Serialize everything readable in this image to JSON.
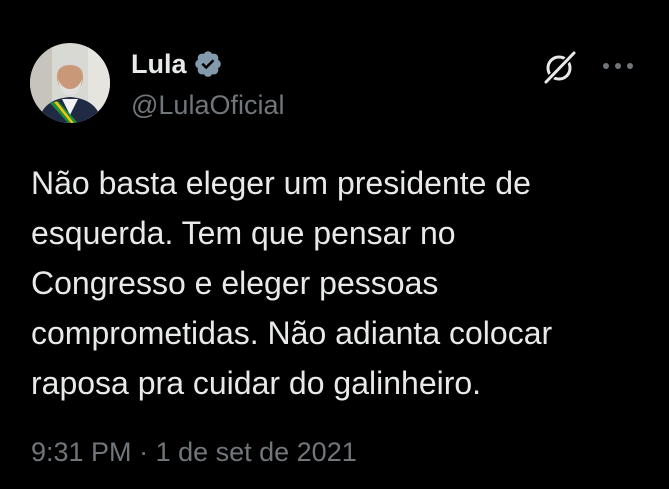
{
  "author": {
    "display_name": "Lula",
    "handle": "@LulaOficial",
    "verified": true,
    "verified_icon": "verified-badge-icon",
    "avatar_icon": "avatar"
  },
  "actions": {
    "grok_icon": "grok-icon",
    "more_icon": "more-options-icon"
  },
  "tweet": {
    "text": "Não basta eleger um presidente de\nesquerda. Tem que pensar no\nCongresso e eleger pessoas\ncomprometidas. Não adianta colocar\nraposa pra cuidar do galinheiro.",
    "time": "9:31 PM",
    "separator": " · ",
    "date": "1 de set de 2021"
  },
  "colors": {
    "background": "#000000",
    "text_primary": "#e7e9ea",
    "text_secondary": "#71767b",
    "verified_badge": "#829aab"
  }
}
